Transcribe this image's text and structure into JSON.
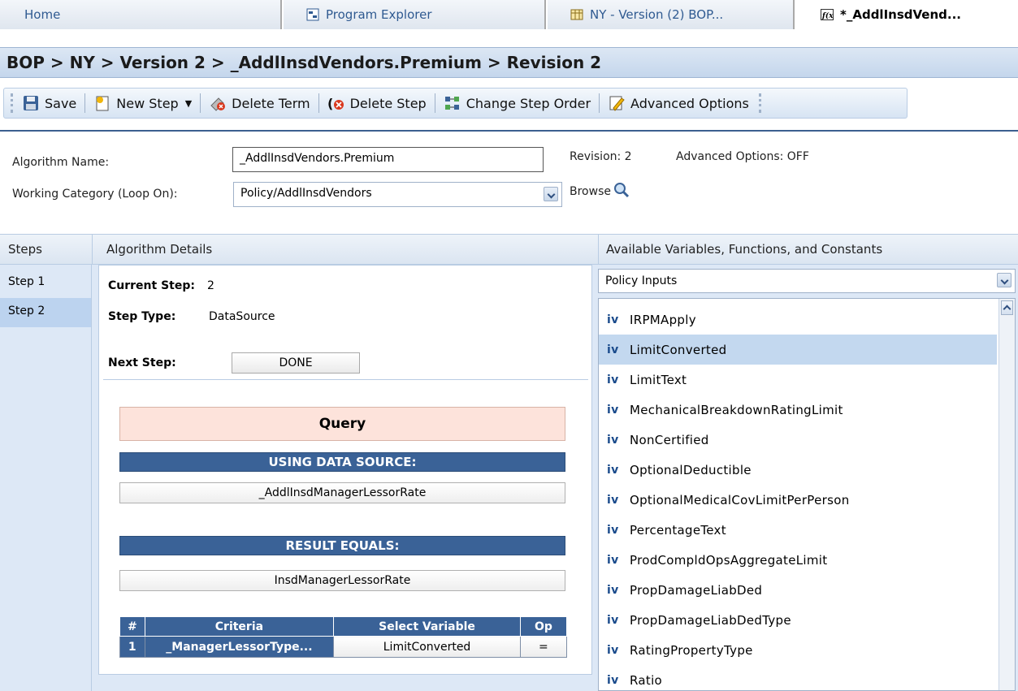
{
  "tabs": [
    {
      "label": "Home",
      "icon": "home-icon"
    },
    {
      "label": "Program Explorer",
      "icon": "program-explorer-icon"
    },
    {
      "label": "NY - Version (2) BOP...",
      "icon": "table-icon"
    },
    {
      "label": "*_AddlInsdVend...",
      "icon": "function-icon",
      "active": true
    }
  ],
  "breadcrumb": "BOP > NY > Version 2 > _AddlInsdVendors.Premium > Revision 2",
  "toolbar": {
    "save": "Save",
    "new_step": "New Step",
    "delete_term": "Delete Term",
    "delete_step": "Delete Step",
    "change_step_order": "Change Step Order",
    "advanced_options": "Advanced Options"
  },
  "header": {
    "algorithm_name_label": "Algorithm Name:",
    "algorithm_name_value": "_AddlInsdVendors.Premium",
    "working_category_label": "Working Category (Loop On):",
    "working_category_value": "Policy/AddlInsdVendors",
    "revision": "Revision: 2",
    "advanced_options_status": "Advanced Options: OFF",
    "browse": "Browse"
  },
  "columns": {
    "steps": "Steps",
    "details": "Algorithm Details",
    "available": "Available Variables, Functions, and Constants"
  },
  "steps": [
    "Step 1",
    "Step 2"
  ],
  "selected_step": "Step 2",
  "details": {
    "current_step_label": "Current Step:",
    "current_step_value": "2",
    "step_type_label": "Step Type:",
    "step_type_value": "DataSource",
    "next_step_label": "Next Step:",
    "next_step_value": "DONE",
    "query_label": "Query",
    "using_data_source_label": "USING DATA SOURCE:",
    "data_source_value": "_AddlInsdManagerLessorRate",
    "result_equals_label": "RESULT EQUALS:",
    "result_value": "InsdManagerLessorRate",
    "criteria_headers": [
      "#",
      "Criteria",
      "Select Variable",
      "Op"
    ],
    "criteria_rows": [
      {
        "num": "1",
        "criteria": "_ManagerLessorType...",
        "variable": "LimitConverted",
        "op": "="
      }
    ]
  },
  "available": {
    "category": "Policy Inputs",
    "prefix": "iv",
    "items": [
      "IRPMApply",
      "LimitConverted",
      "LimitText",
      "MechanicalBreakdownRatingLimit",
      "NonCertified",
      "OptionalDeductible",
      "OptionalMedicalCovLimitPerPerson",
      "PercentageText",
      "ProdCompldOpsAggregateLimit",
      "PropDamageLiabDed",
      "PropDamageLiabDedType",
      "RatingPropertyType",
      "Ratio"
    ],
    "selected_item": "LimitConverted"
  }
}
